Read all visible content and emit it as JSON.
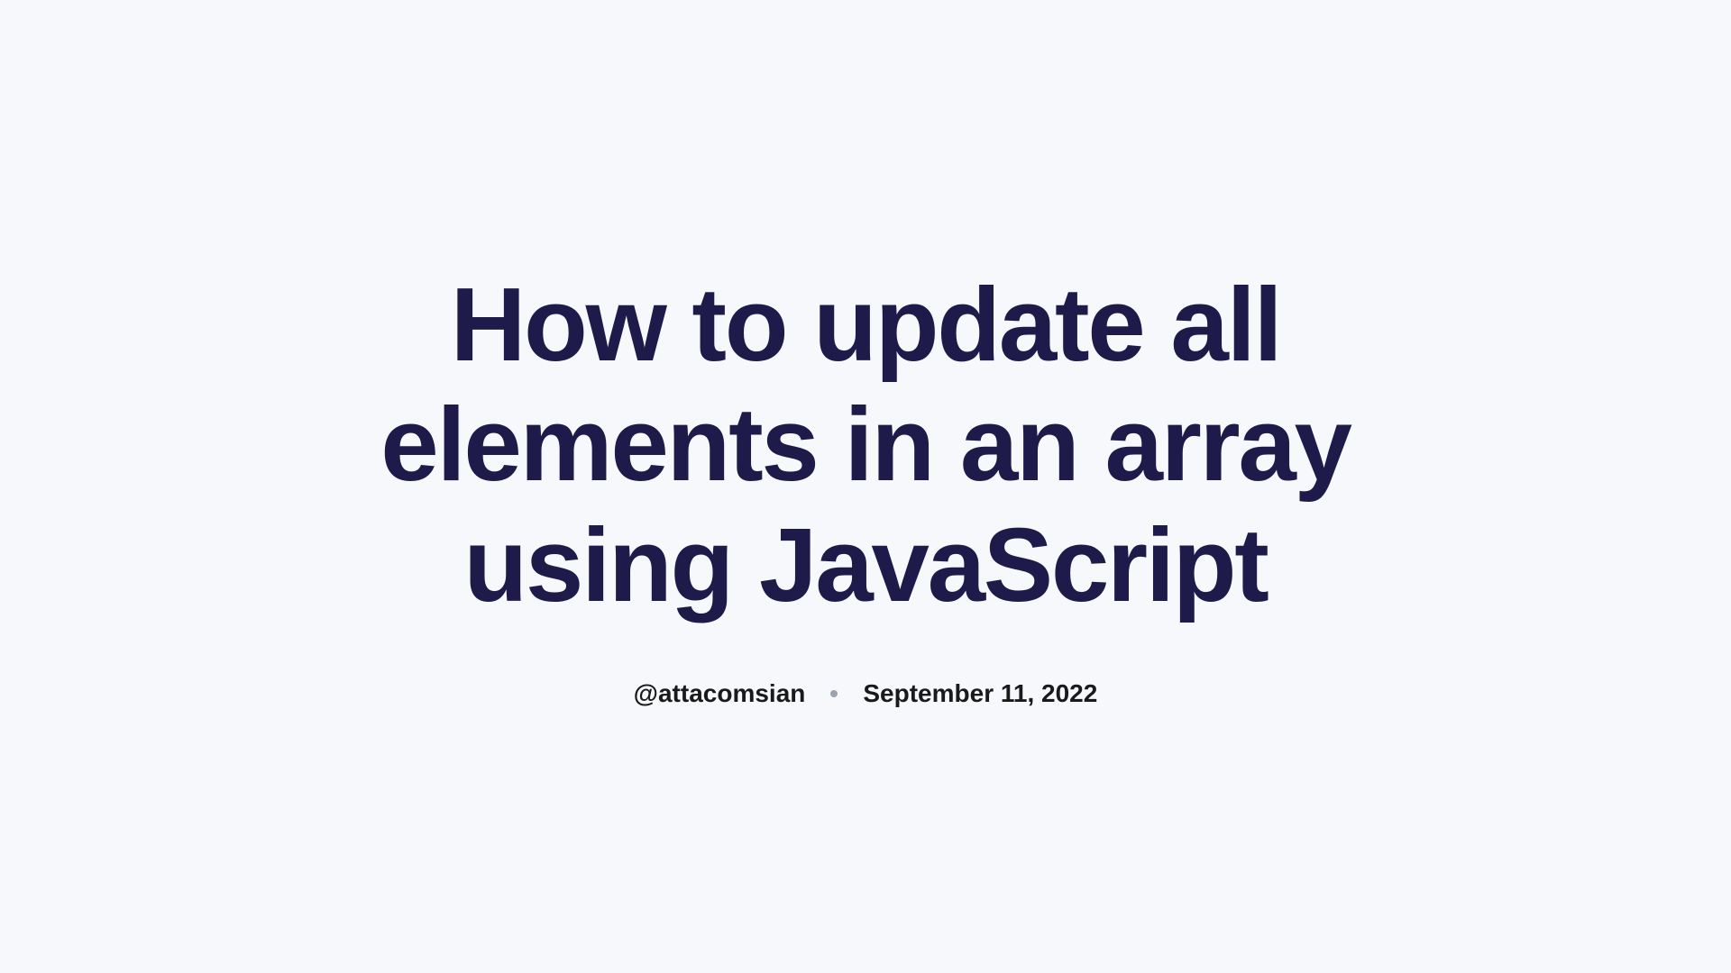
{
  "article": {
    "title": "How to update all elements in an array using JavaScript",
    "author": "@attacomsian",
    "date": "September 11, 2022"
  }
}
